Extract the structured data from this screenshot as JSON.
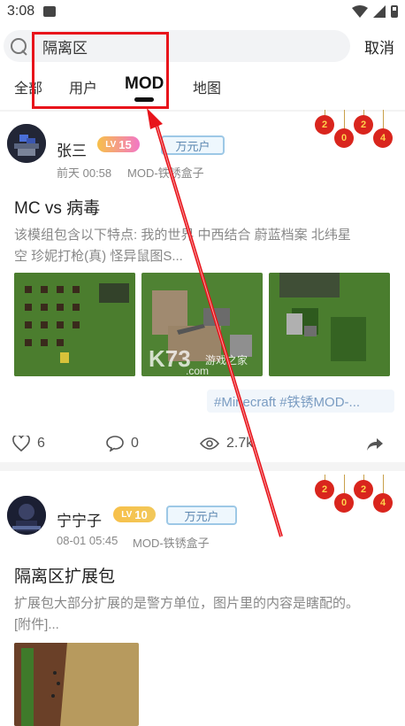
{
  "status": {
    "time": "3:08"
  },
  "search": {
    "query": "隔离区",
    "cancel_label": "取消"
  },
  "tabs": [
    {
      "label": "全部",
      "active": false
    },
    {
      "label": "用户",
      "active": false
    },
    {
      "label": "MOD",
      "active": true
    },
    {
      "label": "地图",
      "active": false
    }
  ],
  "posts": [
    {
      "username": "张三",
      "level": "15",
      "badge": "万元户",
      "time": "前天 00:58",
      "source": "MOD-铁锈盒子",
      "title": "MC vs 病毒",
      "desc_line1": "该模组包含以下特点: 我的世界  中西结合  蔚蓝档案  北纬星",
      "desc_line2": "空  珍妮打枪(真)  怪异鼠图S...",
      "tags": "#Minecraft  #铁锈MOD-...",
      "likes": "6",
      "comments": "0",
      "views": "2.7k",
      "lanterns": [
        "2",
        "0",
        "2",
        "4"
      ]
    },
    {
      "username": "宁宁子",
      "level": "10",
      "badge": "万元户",
      "time": "08-01 05:45",
      "source": "MOD-铁锈盒子",
      "title": "隔离区扩展包",
      "desc_line1": "扩展包大部分扩展的是警方单位，图片里的内容是瞎配的。",
      "desc_line2": "[附件]...",
      "lanterns": [
        "2",
        "0",
        "2",
        "4"
      ]
    }
  ],
  "watermark": {
    "main": "K73",
    "sub": "游戏之家",
    "domain": ".com"
  },
  "colors": {
    "highlight": "#e8141b",
    "arrow": "#e8141b",
    "lv_gradient_start": "#f7b93c",
    "lv_gradient_end": "#f277c6"
  }
}
